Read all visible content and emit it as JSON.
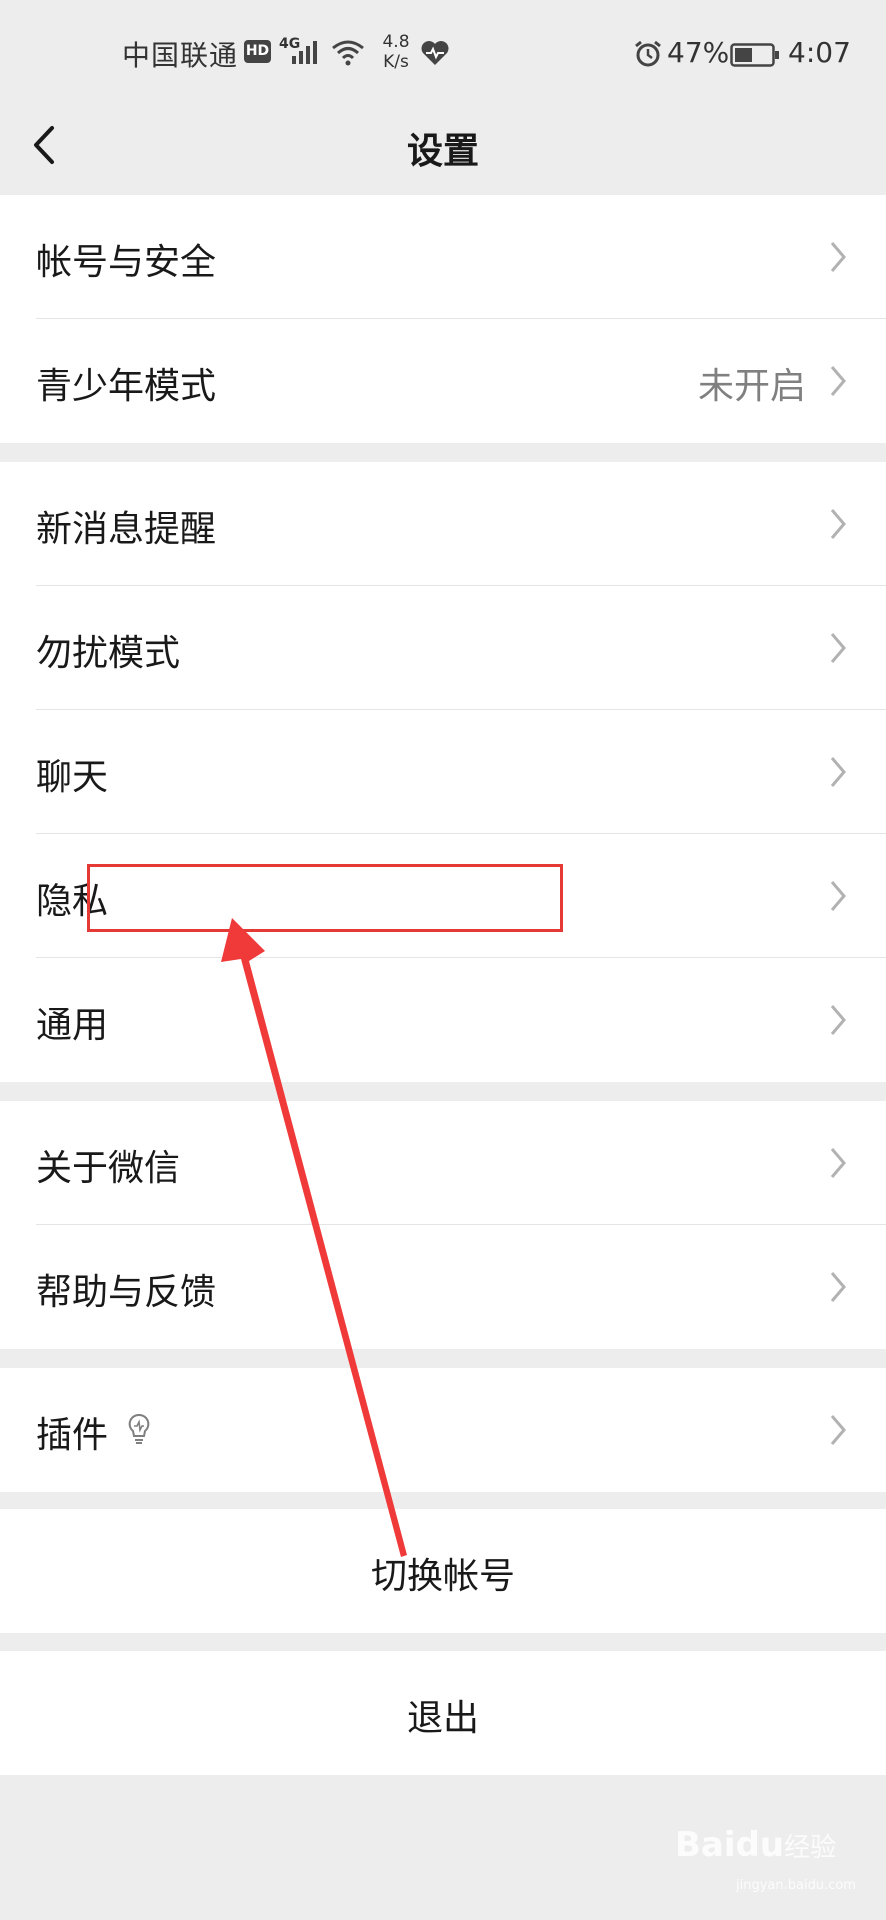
{
  "status_bar": {
    "carrier": "中国联通",
    "hd": "HD",
    "network": "4G",
    "speed_value": "4.8",
    "speed_unit": "K/s",
    "battery_percent": "47%",
    "battery_level": 0.47,
    "time": "4:07"
  },
  "nav": {
    "title": "设置"
  },
  "groups": [
    {
      "items": [
        {
          "label": "帐号与安全"
        },
        {
          "label": "青少年模式",
          "value": "未开启"
        }
      ]
    },
    {
      "items": [
        {
          "label": "新消息提醒"
        },
        {
          "label": "勿扰模式"
        },
        {
          "label": "聊天"
        },
        {
          "label": "隐私"
        },
        {
          "label": "通用"
        }
      ]
    },
    {
      "items": [
        {
          "label": "关于微信"
        },
        {
          "label": "帮助与反馈"
        }
      ]
    },
    {
      "items": [
        {
          "label": "插件"
        }
      ]
    }
  ],
  "actions": {
    "switch_account": "切换帐号",
    "logout": "退出"
  },
  "annotation": {
    "color": "#e53935",
    "highlighted_item": "隐私"
  },
  "watermark": {
    "brand": "Baidu",
    "sub": "经验",
    "url": "jingyan.baidu.com"
  },
  "icons": {
    "back": "back-arrow-icon",
    "chevron": "chevron-right-icon",
    "plugin": "lightbulb-icon"
  }
}
